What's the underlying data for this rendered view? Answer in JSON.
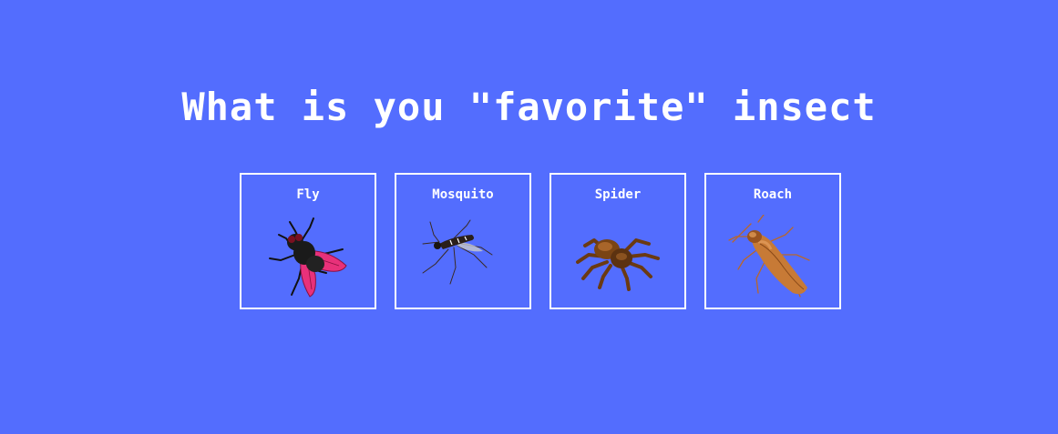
{
  "page": {
    "title": "What is you \"favorite\" insect",
    "background_color": "#536dfe"
  },
  "options": [
    {
      "label": "Fly",
      "icon": "fly-icon"
    },
    {
      "label": "Mosquito",
      "icon": "mosquito-icon"
    },
    {
      "label": "Spider",
      "icon": "spider-icon"
    },
    {
      "label": "Roach",
      "icon": "roach-icon"
    }
  ]
}
